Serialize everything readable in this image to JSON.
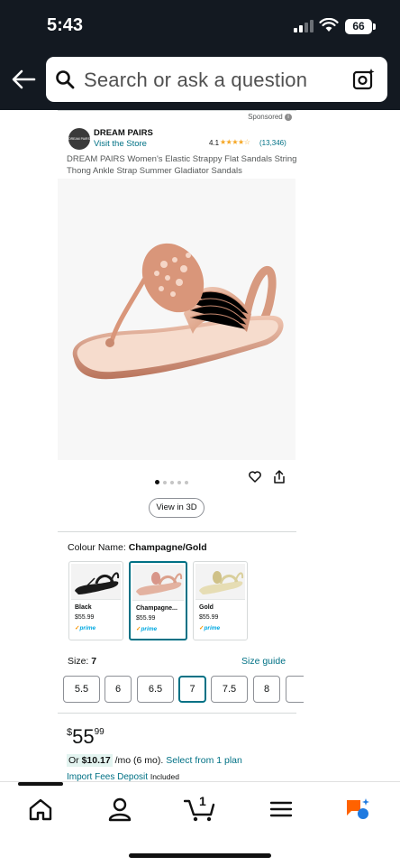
{
  "status": {
    "time": "5:43",
    "battery": "66"
  },
  "search": {
    "placeholder": "Search or ask a question"
  },
  "ad": {
    "sponsored_label": "Sponsored"
  },
  "brand": {
    "logo_text": "DREAM PAIRS",
    "name": "DREAM PAIRS",
    "visit_store": "Visit the Store"
  },
  "rating": {
    "value": "4.1",
    "stars": "★★★★☆",
    "count": "(13,346)"
  },
  "product": {
    "title": "DREAM PAIRS Women's Elastic Strappy Flat Sandals String Thong Ankle Strap Summer Gladiator Sandals",
    "image_count": 5,
    "active_image": 1
  },
  "view_3d_label": "View in 3D",
  "colour": {
    "label": "Colour Name: ",
    "selected": "Champagne/Gold",
    "options": [
      {
        "name": "Black",
        "price": "$55.99",
        "prime": "prime",
        "shoe_color": "#1a1a1a",
        "selected": false
      },
      {
        "name": "Champagne...",
        "price": "$55.99",
        "prime": "prime",
        "shoe_color": "#e3b2a0",
        "selected": true
      },
      {
        "name": "Gold",
        "price": "$55.99",
        "prime": "prime",
        "shoe_color": "#d9cf9c",
        "selected": false
      }
    ]
  },
  "size": {
    "label": "Size: ",
    "selected": "7",
    "guide_label": "Size guide",
    "options": [
      "5.5",
      "6",
      "6.5",
      "7",
      "7.5",
      "8"
    ]
  },
  "price": {
    "currency": "$",
    "whole": "55",
    "fraction": "99"
  },
  "installment": {
    "prefix": "Or ",
    "amount": "$10.17",
    "term": " /mo (6 mo). ",
    "link": "Select from 1 plan"
  },
  "import_fees": {
    "label": "Import Fees Deposit",
    "included": "Included"
  },
  "tabbar": {
    "cart_count": "1"
  },
  "colors": {
    "link": "#007185",
    "selected_border": "#007185",
    "star": "#f5a623",
    "header_bg": "#131921"
  }
}
